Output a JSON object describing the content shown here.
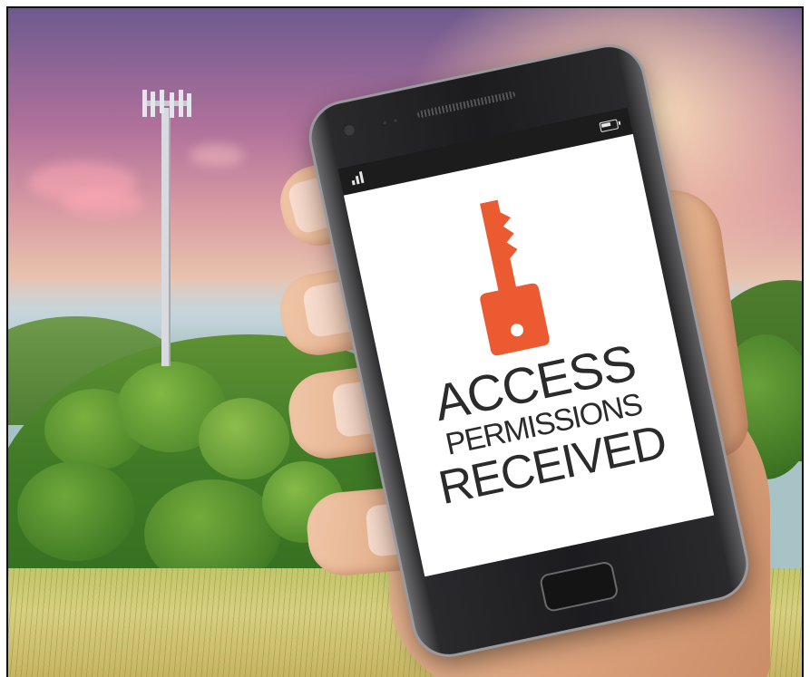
{
  "screen": {
    "line1": "ACCESS",
    "line2": "PERMISSIONS",
    "line3": "RECEIVED"
  },
  "icons": {
    "key": "key-icon",
    "signal": "signal-icon",
    "battery": "battery-icon"
  },
  "colors": {
    "key": "#ec5a32",
    "screen_text": "#2b2b2b",
    "phone_body": "#1c1c1e"
  }
}
